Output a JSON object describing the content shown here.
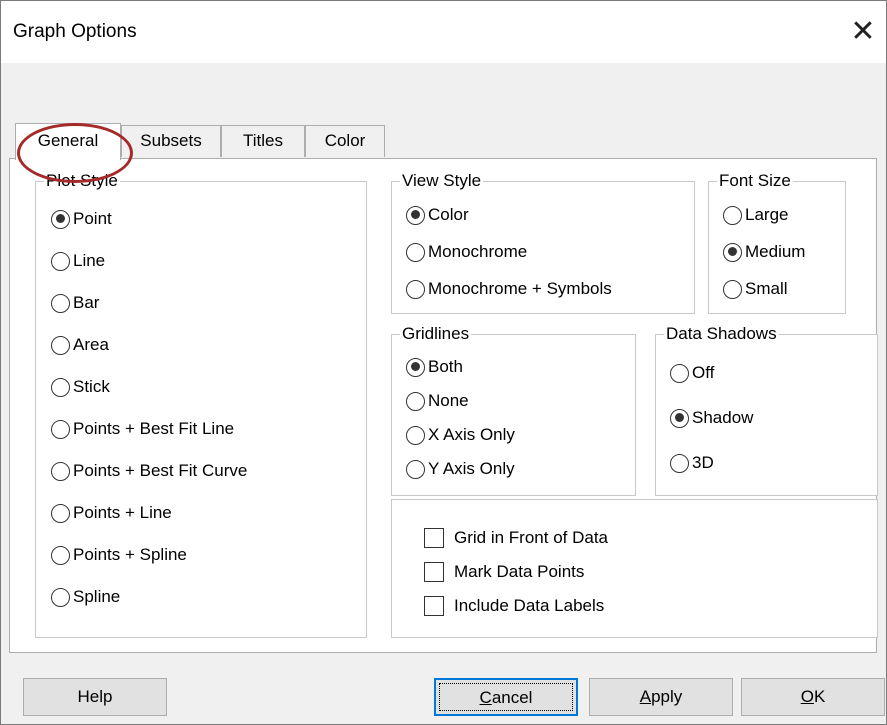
{
  "window": {
    "title": "Graph Options",
    "close_glyph": "✕"
  },
  "tabs": [
    {
      "label": "General",
      "active": true
    },
    {
      "label": "Subsets",
      "active": false
    },
    {
      "label": "Titles",
      "active": false
    },
    {
      "label": "Color",
      "active": false
    }
  ],
  "annotation": {
    "color": "#a52a2a",
    "target": "General tab"
  },
  "plot_style": {
    "legend": "Plot Style",
    "selected": "Point",
    "options": [
      "Point",
      "Line",
      "Bar",
      "Area",
      "Stick",
      "Points + Best Fit Line",
      "Points + Best Fit Curve",
      "Points + Line",
      "Points + Spline",
      "Spline"
    ]
  },
  "view_style": {
    "legend": "View Style",
    "selected": "Color",
    "options": [
      "Color",
      "Monochrome",
      "Monochrome + Symbols"
    ]
  },
  "font_size": {
    "legend": "Font Size",
    "selected": "Medium",
    "options": [
      "Large",
      "Medium",
      "Small"
    ]
  },
  "gridlines": {
    "legend": "Gridlines",
    "selected": "Both",
    "options": [
      "Both",
      "None",
      "X Axis Only",
      "Y Axis Only"
    ]
  },
  "data_shadows": {
    "legend": "Data Shadows",
    "selected": "Shadow",
    "options": [
      "Off",
      "Shadow",
      "3D"
    ]
  },
  "checkboxes": [
    {
      "label": "Grid in Front of Data",
      "checked": false
    },
    {
      "label": "Mark Data Points",
      "checked": false
    },
    {
      "label": "Include Data Labels",
      "checked": false
    }
  ],
  "buttons": {
    "help": "Help",
    "cancel": {
      "accel": "C",
      "rest": "ancel"
    },
    "apply": {
      "accel": "A",
      "rest": "pply"
    },
    "ok": {
      "accel": "O",
      "rest": "K"
    }
  },
  "colors": {
    "focus_border": "#0078d7",
    "panel_bg": "#ffffff",
    "dialog_bg": "#f0f0f0"
  }
}
